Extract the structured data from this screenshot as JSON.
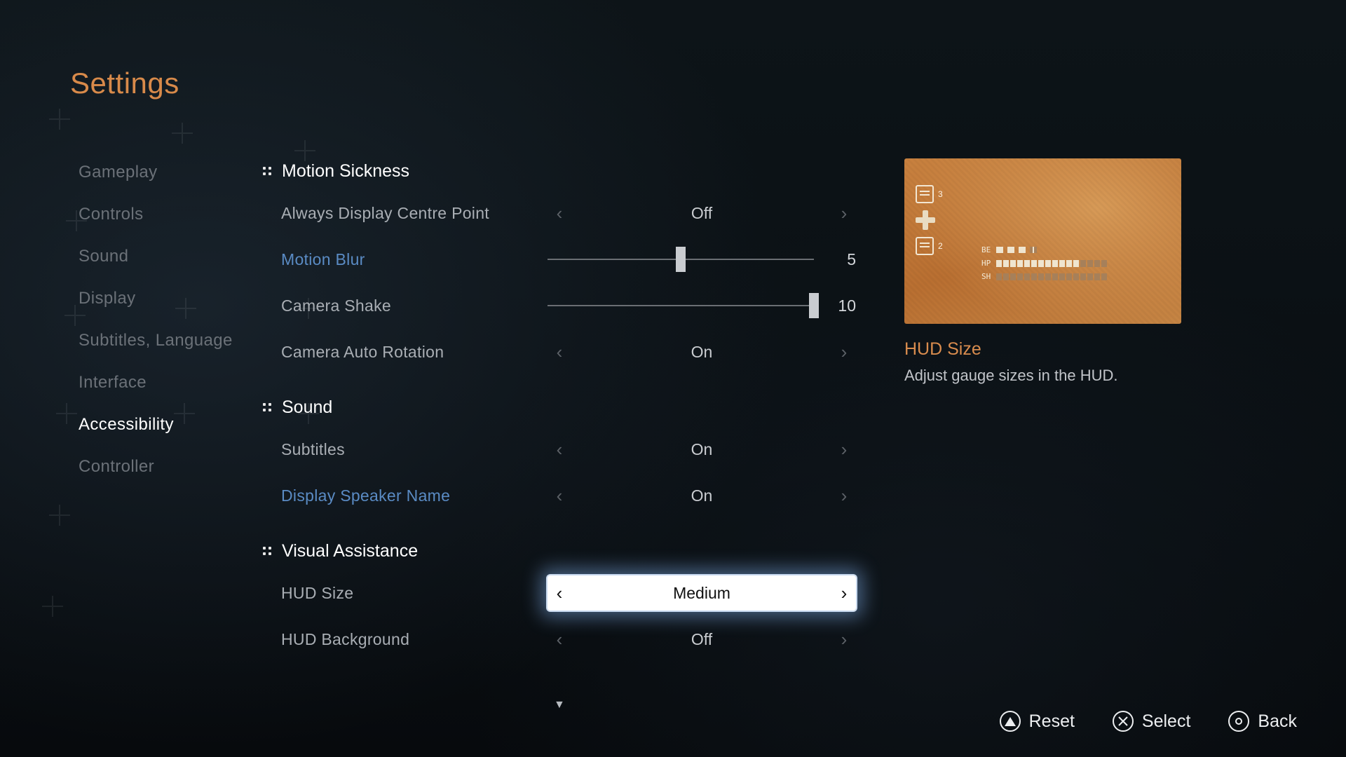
{
  "page_title": "Settings",
  "sidebar": {
    "items": [
      {
        "label": "Gameplay",
        "active": false
      },
      {
        "label": "Controls",
        "active": false
      },
      {
        "label": "Sound",
        "active": false
      },
      {
        "label": "Display",
        "active": false
      },
      {
        "label": "Subtitles, Language",
        "active": false
      },
      {
        "label": "Interface",
        "active": false
      },
      {
        "label": "Accessibility",
        "active": true
      },
      {
        "label": "Controller",
        "active": false
      }
    ]
  },
  "sections": {
    "motion_sickness": {
      "title": "Motion Sickness",
      "always_centre_point": {
        "label": "Always Display Centre Point",
        "value": "Off"
      },
      "motion_blur": {
        "label": "Motion Blur",
        "value": 5,
        "min": 0,
        "max": 10
      },
      "camera_shake": {
        "label": "Camera Shake",
        "value": 10,
        "min": 0,
        "max": 10
      },
      "camera_auto_rot": {
        "label": "Camera Auto Rotation",
        "value": "On"
      }
    },
    "sound": {
      "title": "Sound",
      "subtitles": {
        "label": "Subtitles",
        "value": "On"
      },
      "display_speaker": {
        "label": "Display Speaker Name",
        "value": "On"
      }
    },
    "visual": {
      "title": "Visual Assistance",
      "hud_size": {
        "label": "HUD Size",
        "value": "Medium",
        "highlighted": true
      },
      "hud_background": {
        "label": "HUD Background",
        "value": "Off"
      }
    }
  },
  "detail": {
    "title": "HUD Size",
    "description": "Adjust gauge sizes in the HUD.",
    "hud_preview": {
      "count_top": "3",
      "count_bottom": "2",
      "labels": [
        "BE",
        "HP",
        "SH"
      ]
    }
  },
  "footer": {
    "reset": "Reset",
    "select": "Select",
    "back": "Back"
  },
  "scroll_hint": "▼"
}
